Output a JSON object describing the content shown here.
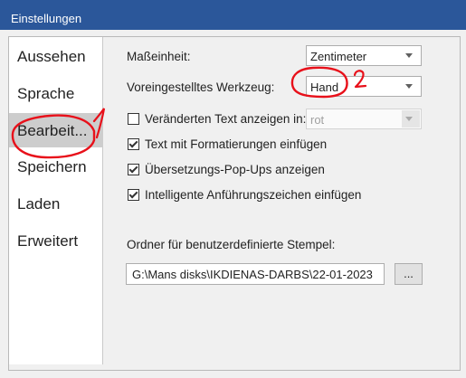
{
  "window": {
    "title": "Einstellungen"
  },
  "sidebar": {
    "items": [
      {
        "label": "Aussehen"
      },
      {
        "label": "Sprache"
      },
      {
        "label": "Bearbeit..."
      },
      {
        "label": "Speichern"
      },
      {
        "label": "Laden"
      },
      {
        "label": "Erweitert"
      }
    ],
    "selected": "Bearbeit..."
  },
  "settings": {
    "unit": {
      "label": "Maßeinheit:",
      "value": "Zentimeter"
    },
    "default_tool": {
      "label": "Voreingestelltes Werkzeug:",
      "value": "Hand"
    },
    "show_changed_text": {
      "label": "Veränderten Text anzeigen in:",
      "checked": false,
      "value": "rot"
    },
    "paste_formatted": {
      "label": "Text mit Formatierungen einfügen",
      "checked": true
    },
    "translation_popups": {
      "label": "Übersetzungs-Pop-Ups anzeigen",
      "checked": true
    },
    "smart_quotes": {
      "label": "Intelligente Anführungszeichen einfügen",
      "checked": true
    },
    "stamp_folder": {
      "label": "Ordner für benutzerdefinierte Stempel:",
      "value": "G:\\Mans disks\\IKDIENAS-DARBS\\22-01-2023",
      "browse_label": "..."
    }
  },
  "annotations": {
    "mark_1": "1",
    "mark_2": "2",
    "color": "#e8101a"
  },
  "colors": {
    "titlebar": "#2b579a",
    "selected": "#cdcdcd"
  }
}
